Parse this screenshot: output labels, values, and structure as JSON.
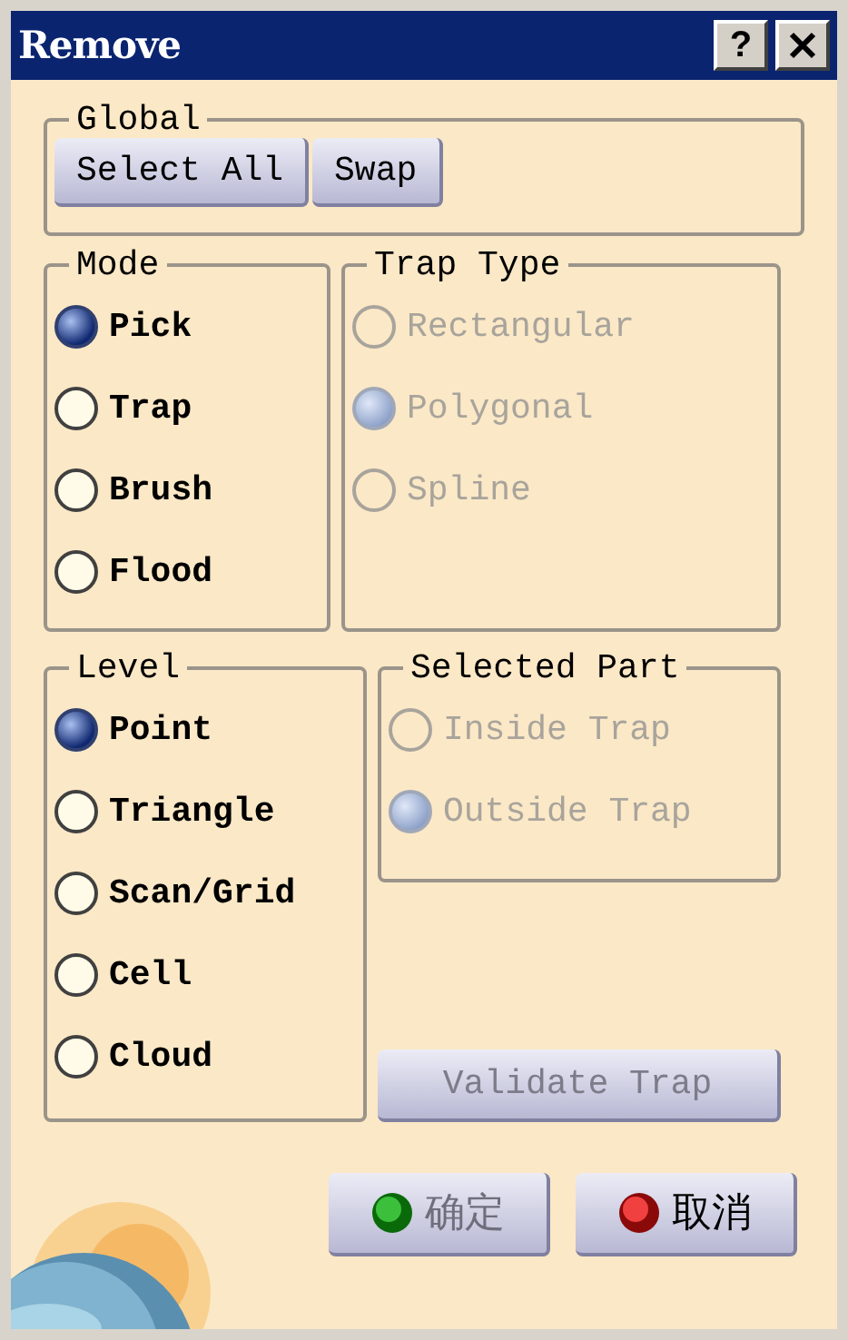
{
  "window": {
    "title": "Remove",
    "help_button": "?"
  },
  "global": {
    "title": "Global",
    "buttons": [
      "Select All",
      "Swap"
    ]
  },
  "mode": {
    "title": "Mode",
    "disabled": false,
    "options": [
      {
        "label": "Pick",
        "selected": true
      },
      {
        "label": "Trap",
        "selected": false
      },
      {
        "label": "Brush",
        "selected": false
      },
      {
        "label": "Flood",
        "selected": false
      }
    ]
  },
  "trap_type": {
    "title": "Trap Type",
    "disabled": true,
    "options": [
      {
        "label": "Rectangular",
        "selected": false
      },
      {
        "label": "Polygonal",
        "selected": true
      },
      {
        "label": "Spline",
        "selected": false
      }
    ]
  },
  "level": {
    "title": "Level",
    "disabled": false,
    "options": [
      {
        "label": "Point",
        "selected": true
      },
      {
        "label": "Triangle",
        "selected": false
      },
      {
        "label": "Scan/Grid",
        "selected": false
      },
      {
        "label": "Cell",
        "selected": false
      },
      {
        "label": "Cloud",
        "selected": false
      }
    ]
  },
  "selected_part": {
    "title": "Selected Part",
    "disabled": true,
    "options": [
      {
        "label": "Inside Trap",
        "selected": false
      },
      {
        "label": "Outside Trap",
        "selected": true
      }
    ]
  },
  "validate_button": {
    "label": "Validate Trap",
    "disabled": true
  },
  "dialog_buttons": [
    {
      "kind": "ok",
      "label": "确定",
      "disabled": true
    },
    {
      "kind": "cancel",
      "label": "取消",
      "disabled": false
    }
  ]
}
